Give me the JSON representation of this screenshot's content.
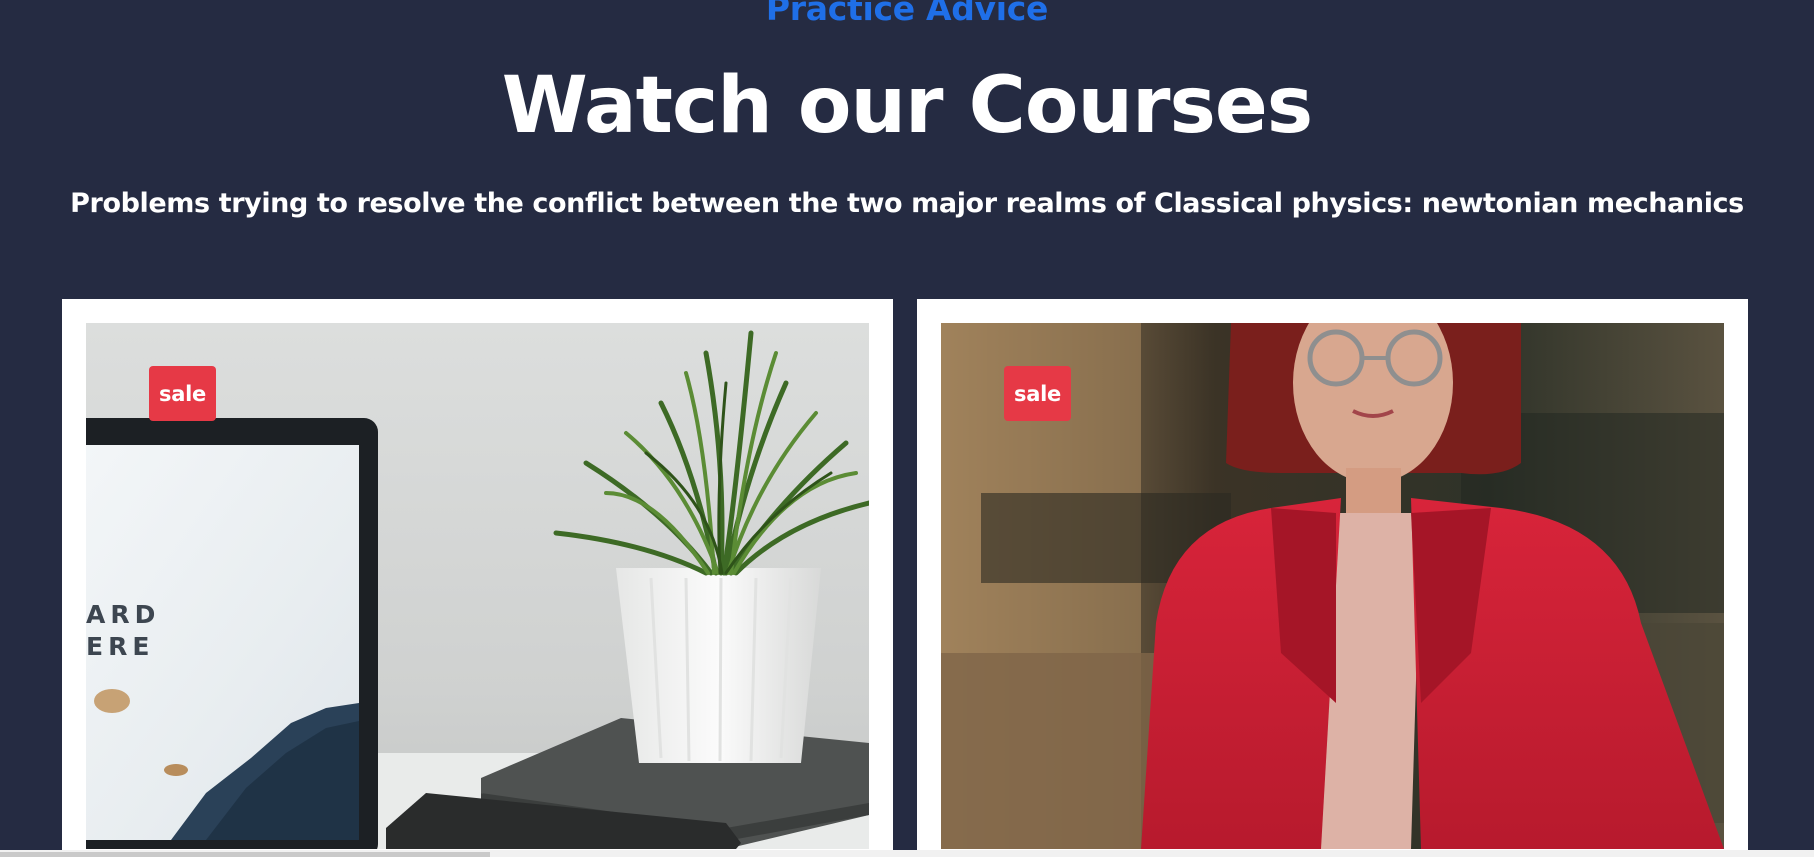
{
  "section": {
    "eyebrow": "Practice Advice",
    "title": "Watch our Courses",
    "subtitle": "Problems trying to resolve the conflict between the two major realms of Classical physics: newtonian mechanics"
  },
  "courses": [
    {
      "badge": "sale",
      "image_icon": "desk-laptop-plant-image"
    },
    {
      "badge": "sale",
      "image_icon": "woman-red-jacket-portrait-image"
    }
  ],
  "colors": {
    "background": "#252b42",
    "eyebrow": "#1f6fe8",
    "badge": "#e63946",
    "card": "#ffffff"
  }
}
